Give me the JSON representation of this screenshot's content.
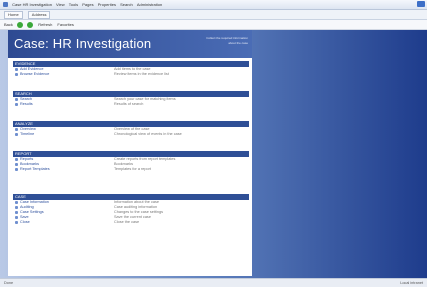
{
  "window": {
    "title_segments": [
      "Case HR Investigation",
      "View",
      "Tools",
      "Pages",
      "Properties",
      "Search",
      "Administration"
    ]
  },
  "toolbar": {
    "tabs": [
      "Home",
      "Address"
    ],
    "buttons": [
      "Back",
      "Forward",
      "Refresh",
      "Favorites"
    ]
  },
  "page": {
    "title": "Case: HR Investigation",
    "subtitle_line1": "Collect the required information",
    "subtitle_line2": "about the case"
  },
  "sections": [
    {
      "heading": "EVIDENCE",
      "items": [
        {
          "label": "Add Evidence",
          "desc": "Add items to the case"
        },
        {
          "label": "Browse Evidence",
          "desc": "Review items in the evidence list"
        }
      ]
    },
    {
      "heading": "SEARCH",
      "items": [
        {
          "label": "Search",
          "desc": "Search your case for matching items"
        },
        {
          "label": "Results",
          "desc": "Results of search"
        }
      ]
    },
    {
      "heading": "ANALYZE",
      "items": [
        {
          "label": "Overview",
          "desc": "Overview of the case"
        },
        {
          "label": "Timeline",
          "desc": "Chronological view of events in the case"
        }
      ]
    },
    {
      "heading": "REPORT",
      "items": [
        {
          "label": "Reports",
          "desc": "Create reports from report templates"
        },
        {
          "label": "Bookmarks",
          "desc": "Bookmarks"
        },
        {
          "label": "Report Templates",
          "desc": "Templates for a report"
        }
      ]
    },
    {
      "heading": "CASE",
      "items": [
        {
          "label": "Case Information",
          "desc": "Information about the case"
        },
        {
          "label": "Auditing",
          "desc": "Case auditing information"
        },
        {
          "label": "Case Settings",
          "desc": "Changes to the case settings"
        },
        {
          "label": "Save",
          "desc": "Save the current case"
        },
        {
          "label": "Close",
          "desc": "Close the case"
        }
      ]
    }
  ],
  "status": {
    "left": "Done",
    "right": "Local intranet"
  }
}
